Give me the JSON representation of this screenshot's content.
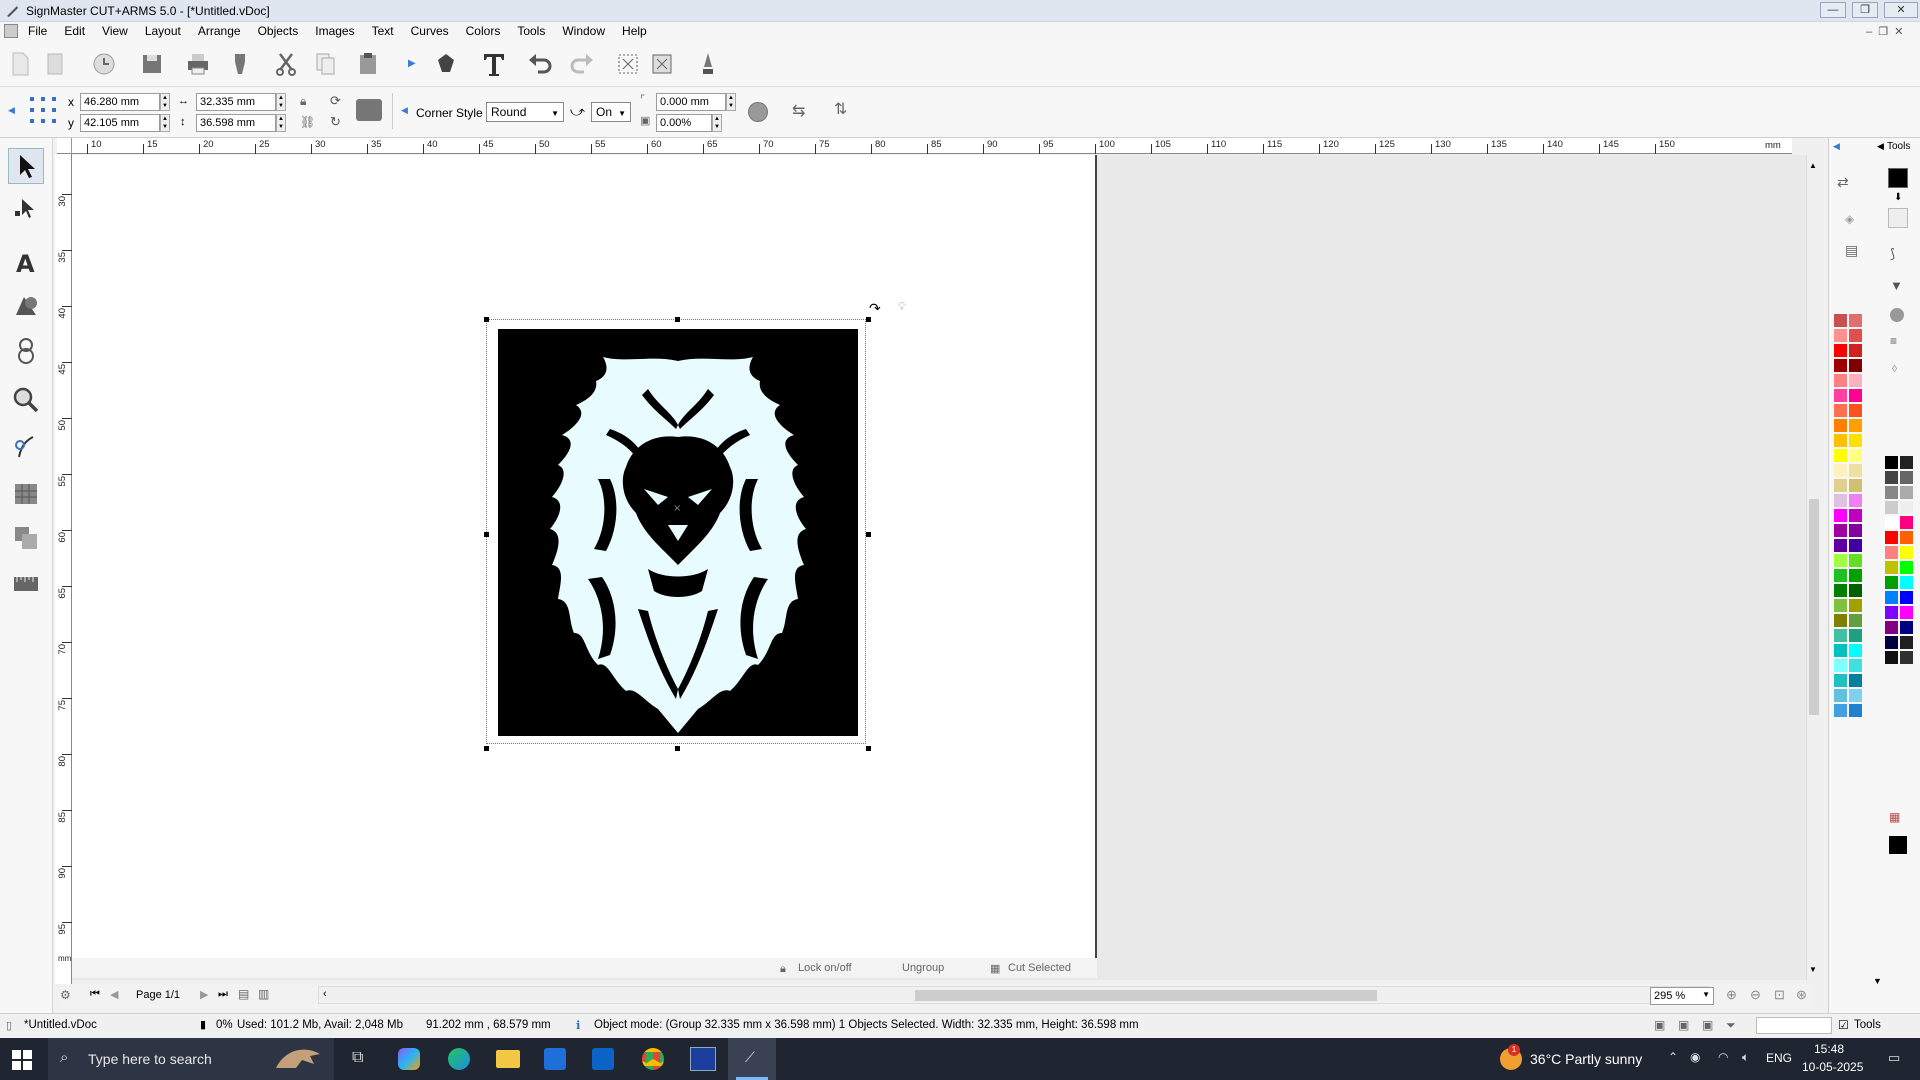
{
  "app": {
    "title": "SignMaster CUT+ARMS 5.0 - [*Untitled.vDoc]"
  },
  "menu": [
    "File",
    "Edit",
    "View",
    "Layout",
    "Arrange",
    "Objects",
    "Images",
    "Text",
    "Curves",
    "Colors",
    "Tools",
    "Window",
    "Help"
  ],
  "props": {
    "x": "46.280 mm",
    "y": "42.105 mm",
    "width": "32.335 mm",
    "height": "36.598 mm",
    "x_label": "x",
    "y_label": "y",
    "corner_style_label": "Corner Style",
    "corner_style": "Round",
    "on_value": "On",
    "radius": "0.000 mm",
    "percent": "0.00%"
  },
  "ruler": {
    "h_ticks": [
      "10",
      "15",
      "20",
      "25",
      "30",
      "35",
      "40",
      "45",
      "50",
      "55",
      "60",
      "65",
      "70",
      "75",
      "80",
      "85",
      "90",
      "95",
      "100",
      "105",
      "110",
      "115",
      "120",
      "125",
      "130",
      "135",
      "140",
      "145",
      "150"
    ],
    "h_unit": "mm",
    "v_ticks": [
      "30",
      "35",
      "40",
      "45",
      "50",
      "55",
      "60",
      "65",
      "70",
      "75",
      "80",
      "85",
      "90",
      "95"
    ],
    "v_unit": "mm"
  },
  "canvas_actions": {
    "lock": "Lock on/off",
    "ungroup": "Ungroup",
    "cut_selected": "Cut Selected"
  },
  "pager": {
    "page": "Page 1/1",
    "zoom": "295 %"
  },
  "status": {
    "doc": "*Untitled.vDoc",
    "memory_pct": "0%",
    "memory": "Used: 101.2 Mb, Avail: 2,048 Mb",
    "coords": "91.202 mm , 68.579 mm",
    "mode": "Object mode: (Group 32.335 mm x 36.598 mm)  1 Objects Selected.  Width: 32.335 mm, Height: 36.598 mm",
    "tools_label": "Tools"
  },
  "panel": {
    "tools_header": "Tools"
  },
  "taskbar": {
    "search": "Type here to search",
    "weather": "36°C  Partly sunny",
    "lang": "ENG",
    "time": "15:48",
    "date": "10-05-2025",
    "notif": "1"
  },
  "palette_left": [
    "#c85050",
    "#e07070",
    "#ff9090",
    "#e05050",
    "#ff0000",
    "#d02020",
    "#a00000",
    "#800000",
    "#ff8080",
    "#ffb0c0",
    "#ff40a0",
    "#ff0090",
    "#ff7050",
    "#ff5020",
    "#ff8000",
    "#ffa000",
    "#ffc000",
    "#ffe000",
    "#ffff00",
    "#ffff80",
    "#fff0c0",
    "#f0e0a0",
    "#e0d090",
    "#d0c070",
    "#e0c0e0",
    "#f080f0",
    "#ff00ff",
    "#c000c0",
    "#a000a0",
    "#8000a0",
    "#6000a0",
    "#4000a0",
    "#a0ff40",
    "#60e020",
    "#20c020",
    "#00a000",
    "#008000",
    "#006000",
    "#80c040",
    "#a0a000",
    "#808000",
    "#60a040",
    "#40c0a0",
    "#20a080",
    "#00c0c0",
    "#00ffff",
    "#80ffff",
    "#40e0e0",
    "#20c0c0",
    "#0080a0",
    "#60c0e0",
    "#80d0f0",
    "#40a0e0",
    "#2080d0"
  ],
  "palette_right": [
    "#000000",
    "#222222",
    "#444444",
    "#666666",
    "#888888",
    "#aaaaaa",
    "#cccccc",
    "#eeeeee",
    "#ffffff",
    "#ff0080",
    "#ff0000",
    "#ff6000",
    "#ff8080",
    "#ffff00",
    "#c0c000",
    "#00ff00",
    "#00a000",
    "#00ffff",
    "#0080ff",
    "#0000ff",
    "#8000ff",
    "#ff00ff",
    "#800080",
    "#000080",
    "#000040",
    "#202020",
    "#101010",
    "#303030"
  ]
}
